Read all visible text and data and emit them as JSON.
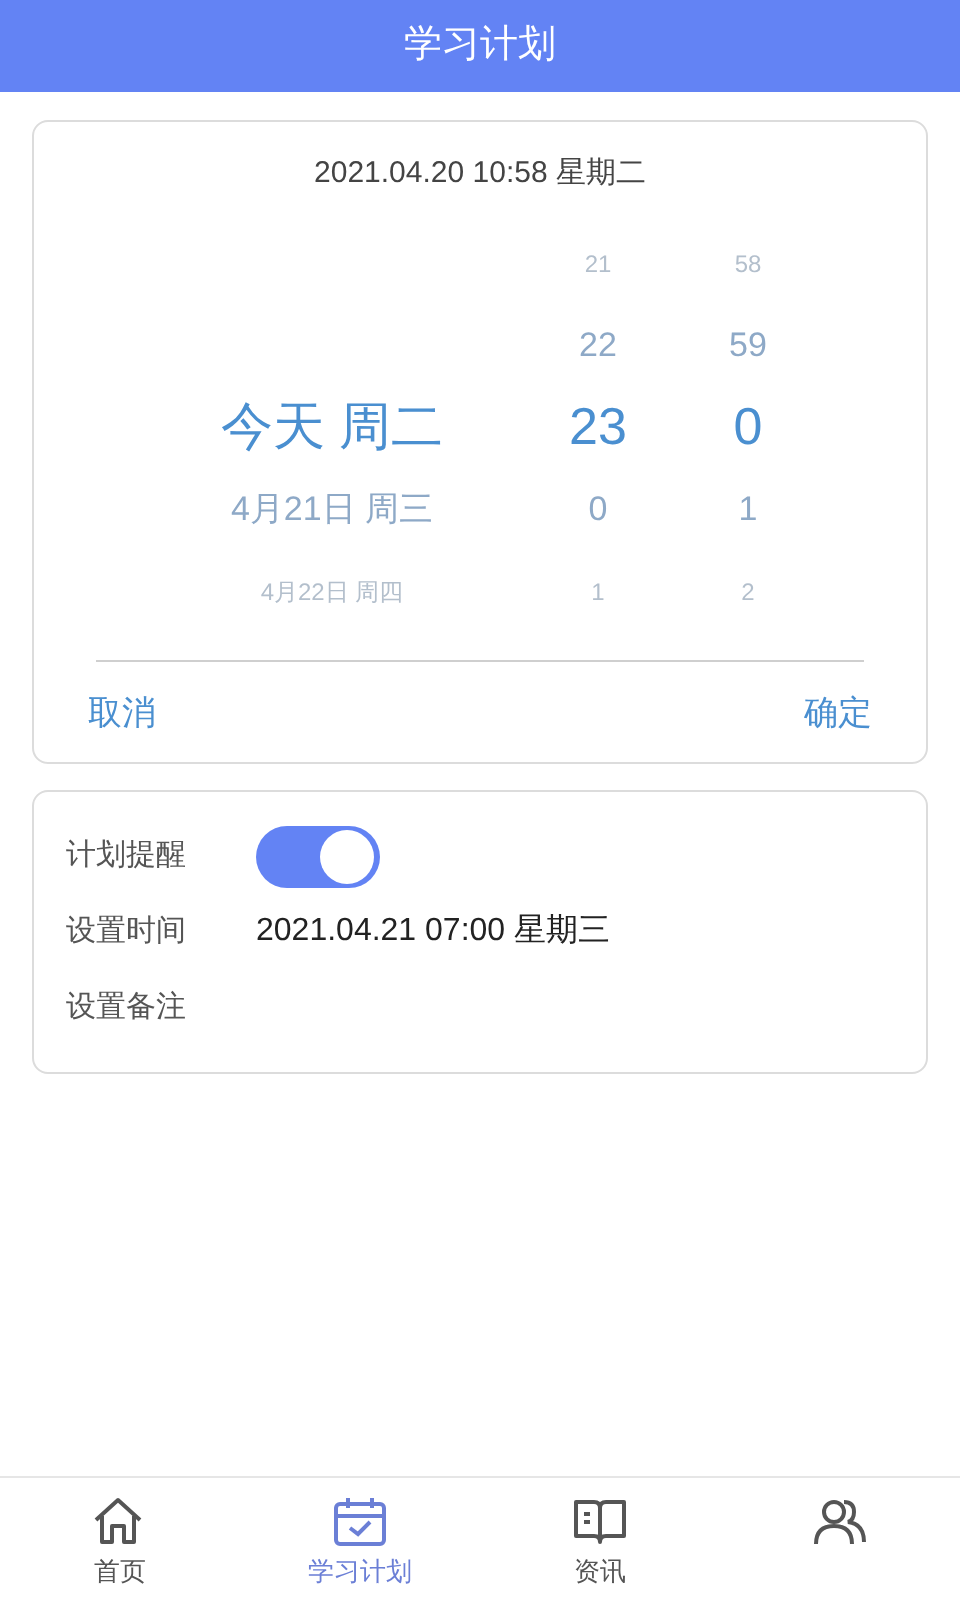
{
  "header": {
    "title": "学习计划"
  },
  "picker": {
    "current_time": "2021.04.20 10:58 星期二",
    "rows": [
      {
        "hour": "21",
        "minute": "58",
        "selected": false
      },
      {
        "hour": "22",
        "minute": "59",
        "selected": false
      },
      {
        "date": "今天 周二",
        "hour": "23",
        "minute": "0",
        "selected": true
      },
      {
        "date": "4月21日 周三",
        "hour": "0",
        "minute": "1",
        "selected": false
      },
      {
        "date": "4月22日 周四",
        "hour": "1",
        "minute": "2",
        "selected": false
      }
    ],
    "cancel": "取消",
    "confirm": "确定"
  },
  "settings": {
    "reminder_label": "计划提醒",
    "reminder_on": true,
    "time_label": "设置时间",
    "time_value": "2021.04.21 07:00 星期三",
    "note_label": "设置备注"
  },
  "tabs": [
    {
      "kind": "home",
      "label": "首页",
      "selected": false
    },
    {
      "kind": "calendar",
      "label": "学习计划",
      "selected": true
    },
    {
      "kind": "book",
      "label": "资讯",
      "selected": false
    },
    {
      "kind": "people",
      "selected": false
    }
  ]
}
